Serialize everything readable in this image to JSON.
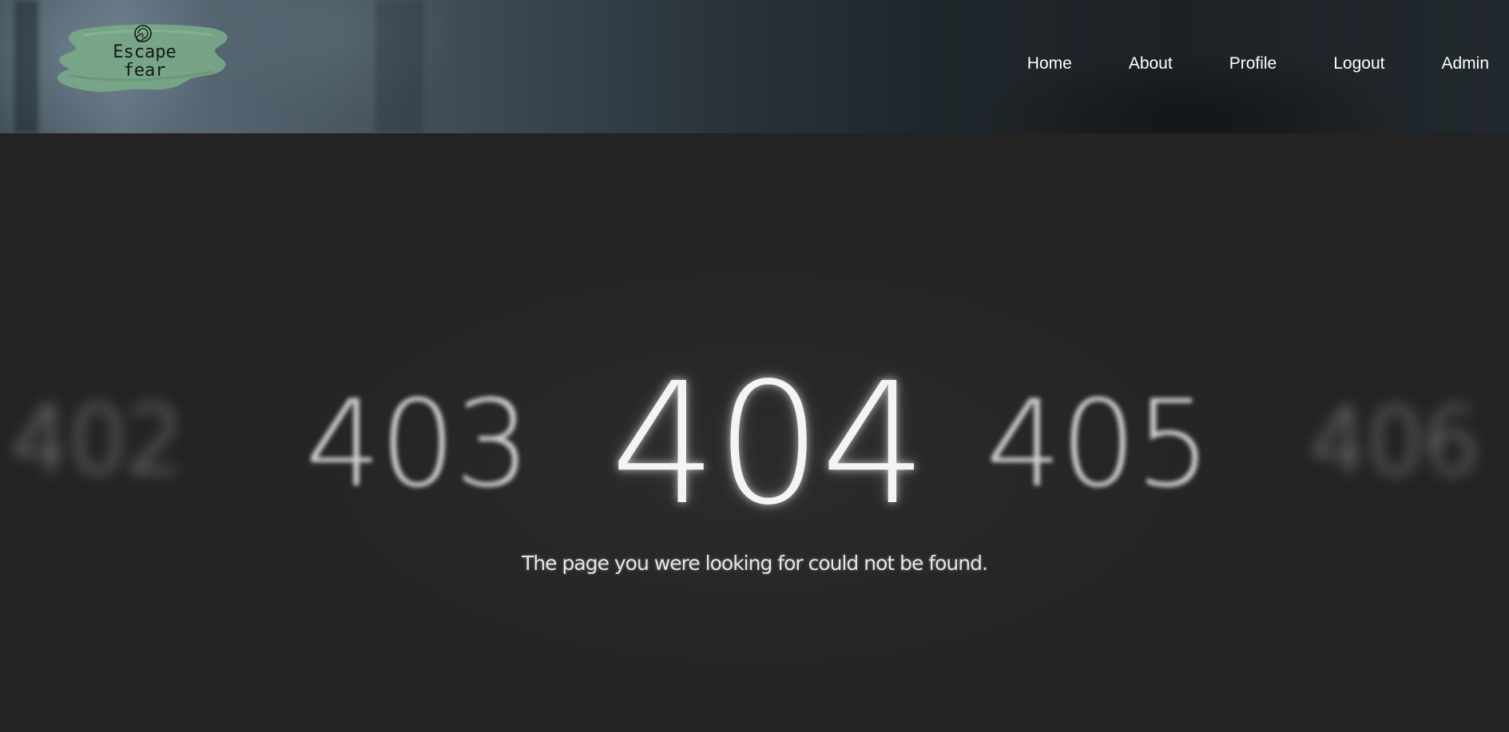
{
  "header": {
    "logo": {
      "line1": "Escape",
      "line2": "fear",
      "brush_color": "#7aa889",
      "emblem_icon": "spiral-emblem-icon"
    },
    "nav": [
      {
        "label": "Home"
      },
      {
        "label": "About"
      },
      {
        "label": "Profile"
      },
      {
        "label": "Logout"
      },
      {
        "label": "Admin"
      }
    ]
  },
  "main": {
    "codes": {
      "prev2": "402",
      "prev1": "403",
      "current": "404",
      "next1": "405",
      "next2": "406"
    },
    "message": "The page you were looking for could not be found."
  },
  "colors": {
    "background": "#252525",
    "text": "#ffffff"
  }
}
